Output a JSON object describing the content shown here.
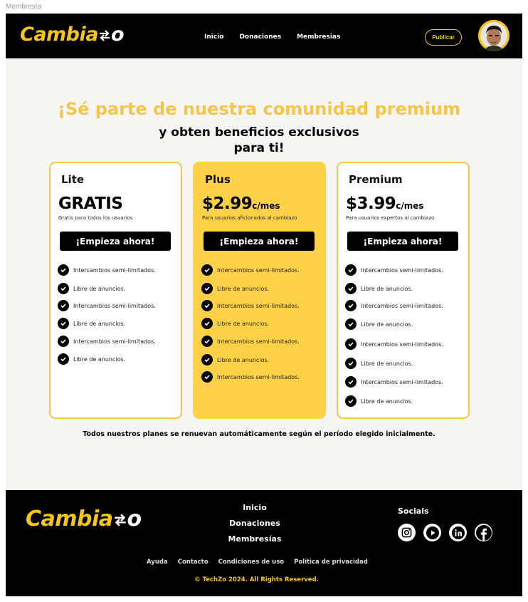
{
  "frame": {
    "label": "Membresía"
  },
  "header": {
    "logo_text": "Cambia",
    "logo_tail": "o",
    "nav": [
      "Inicio",
      "Donaciones",
      "Membresias"
    ],
    "publish_label": "Publicar"
  },
  "hero": {
    "title": "¡Sé parte de nuestra comunidad premium",
    "subtitle_line1": "y obten beneficios exclusivos",
    "subtitle_line2": "para ti!"
  },
  "plans": [
    {
      "name": "Lite",
      "price": "GRATIS",
      "period": "",
      "description": "Gratis para todos los usuarios",
      "cta": "¡Empieza ahora!",
      "features": [
        "Intercambios semi-limitados.",
        "Libre de anuncios.",
        "Intercambios semi-limitados.",
        "Libre de anuncios.",
        "Intercambios semi-limitados.",
        "Libre de anuncios."
      ]
    },
    {
      "name": "Plus",
      "price": "$2.99",
      "period": "c/mes",
      "description": "Para usuarios aficionados al cambiazo",
      "cta": "¡Empieza ahora!",
      "features": [
        "Intercambios semi-limitados.",
        "Libre de anuncios.",
        "Intercambios semi-limitados.",
        "Libre de anuncios.",
        "Intercambios semi-limitados.",
        "Libre de anuncios.",
        "Intercambios semi-limitados."
      ]
    },
    {
      "name": "Premium",
      "price": "$3.99",
      "period": "c/mes",
      "description": "Para usuarios expertos al cambiazo",
      "cta": "¡Empieza ahora!",
      "features": [
        "Intercambios semi-limitados.",
        "Libre de anuncios.",
        "Intercambios semi-limitados.",
        "Libre de anuncios.",
        "Intercambios semi-limitados.",
        "Libre de anuncios.",
        "Intercambios semi-limitados.",
        "Libre de anuncios."
      ]
    }
  ],
  "renew_note": "Todos nuestros planes se renuevan automáticamente según el período elegido inicialmente.",
  "footer": {
    "logo_text": "Cambia",
    "logo_tail": "o",
    "nav": [
      "Inicio",
      "Donaciones",
      "Membresías"
    ],
    "socials_title": "Socials",
    "social_icons": [
      "instagram-icon",
      "youtube-icon",
      "linkedin-icon",
      "facebook-icon"
    ],
    "links": [
      "Ayuda",
      "Contacto",
      "Condiciones de uso",
      "Política de privacidad"
    ],
    "copyright": "© TechZo 2024. All Rights Reserved."
  },
  "colors": {
    "brand_yellow": "#f5c518",
    "title_yellow": "#f7c548",
    "plus_card": "#ffd147",
    "black": "#000000",
    "background": "#f6f5f2"
  }
}
